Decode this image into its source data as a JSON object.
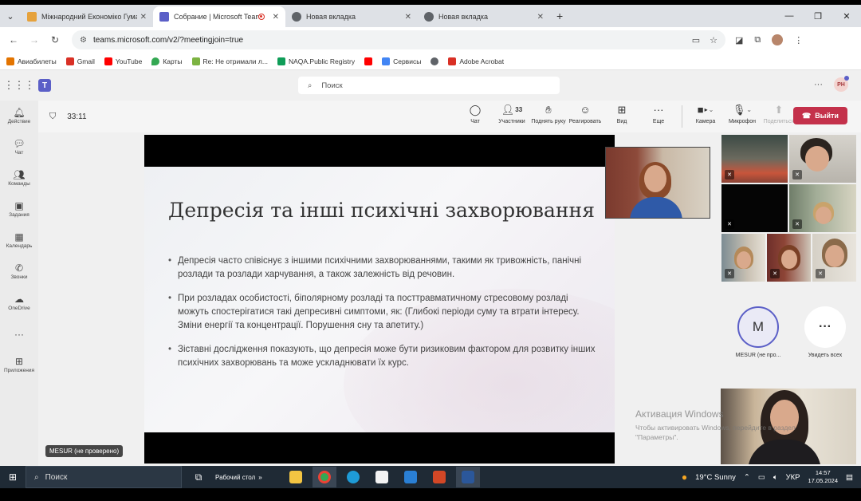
{
  "browser": {
    "tabs": [
      {
        "title": "Міжнародний Економіко Гума",
        "favicon_color": "#e6a23c",
        "active": false
      },
      {
        "title": "Собрание | Microsoft Teams",
        "favicon_color": "#5b5fc7",
        "active": true,
        "recording": true
      },
      {
        "title": "Новая вкладка",
        "favicon_color": "#5f6368",
        "active": false
      },
      {
        "title": "Новая вкладка",
        "favicon_color": "#5f6368",
        "active": false
      }
    ],
    "url": "teams.microsoft.com/v2/?meetingjoin=true",
    "bookmarks": [
      {
        "label": "Авиабилеты",
        "color": "#e37400"
      },
      {
        "label": "Gmail",
        "color": "#d93025"
      },
      {
        "label": "YouTube",
        "color": "#ff0000"
      },
      {
        "label": "Карты",
        "color": "#34a853"
      },
      {
        "label": "Re: Не отримали л...",
        "color": "#7cb342"
      },
      {
        "label": "NAQA.Public Registry",
        "color": "#0f9d58"
      },
      {
        "label": "",
        "color": "#ff0000"
      },
      {
        "label": "Сервисы",
        "color": "#4285f4"
      },
      {
        "label": "",
        "color": "#5f6368"
      },
      {
        "label": "Adobe Acrobat",
        "color": "#d93025"
      }
    ]
  },
  "teams": {
    "search_placeholder": "Поиск",
    "profile_initials": "PH",
    "rail": [
      {
        "label": "Действие",
        "icon": "bell-icon",
        "glyph": "🔔"
      },
      {
        "label": "Чат",
        "icon": "chat-icon",
        "glyph": "💬"
      },
      {
        "label": "Команды",
        "icon": "teams-icon",
        "glyph": "👥"
      },
      {
        "label": "Задания",
        "icon": "assignments-icon",
        "glyph": "🎒"
      },
      {
        "label": "Календарь",
        "icon": "calendar-icon",
        "glyph": "📅"
      },
      {
        "label": "Звонки",
        "icon": "phone-icon",
        "glyph": "📞"
      },
      {
        "label": "OneDrive",
        "icon": "cloud-icon",
        "glyph": "☁"
      },
      {
        "label": "",
        "icon": "more-icon",
        "glyph": "···"
      },
      {
        "label": "Приложения",
        "icon": "add-apps-icon",
        "glyph": "⊕"
      }
    ],
    "meeting": {
      "timer": "33:11",
      "participants_count": "33",
      "tools": [
        {
          "label": "Чат",
          "icon": "chat-icon",
          "glyph": "💬"
        },
        {
          "label": "Участники",
          "icon": "people-icon",
          "glyph": "👤"
        },
        {
          "label": "Поднять руку",
          "icon": "hand-icon",
          "glyph": "✋"
        },
        {
          "label": "Реагировать",
          "icon": "smile-icon",
          "glyph": "☺"
        },
        {
          "label": "Вид",
          "icon": "grid-view-icon",
          "glyph": "⊞"
        },
        {
          "label": "Еще",
          "icon": "more-icon",
          "glyph": "···"
        }
      ],
      "devices": [
        {
          "label": "Камера",
          "icon": "camera-icon",
          "glyph": "■"
        },
        {
          "label": "Микрофон",
          "icon": "mic-off-icon",
          "glyph": "🎙"
        },
        {
          "label": "Поделиться",
          "icon": "share-icon",
          "glyph": "⬆"
        }
      ],
      "leave_label": "Выйти"
    },
    "slide": {
      "title": "Депресія та інші психічні захворювання",
      "bullets": [
        "Депресія часто співіснує з іншими психічними захворюваннями, такими як тривожність, панічні розлади та розлади харчування, а також залежність від речовин.",
        "При розладах особистості, біполярному розладі та посттравматичному стресовому розладі можуть спостерігатися такі депресивні симптоми, як: (Глибокі періоди суму та втрати інтересу. Зміни енергії та концентрації. Порушення сну та апетиту.)",
        "Зіставні дослідження показують, що депресія може бути ризиковим фактором для розвитку інших психічних захворювань та може ускладнювати їх курс."
      ]
    },
    "presenter_name_tag": "MESUR (не проверено)",
    "gallery": {
      "avatar_initial": "M",
      "avatar_name": "MESUR (не про...",
      "see_all_label": "Увидеть всех"
    }
  },
  "windows": {
    "activation_title": "Активация Windows",
    "activation_text": "Чтобы активировать Windows, перейдите в раздел \"Параметры\".",
    "search_label": "Поиск",
    "desktop_label": "Рабочий стол",
    "weather": "19°C  Sunny",
    "language": "УКР",
    "time": "14:57",
    "date": "17.05.2024"
  }
}
